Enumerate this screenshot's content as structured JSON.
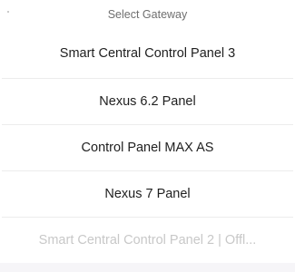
{
  "sheet": {
    "title": "Select Gateway",
    "options": [
      {
        "label": "Smart Central Control Panel 3",
        "disabled": false
      },
      {
        "label": "Nexus 6.2 Panel",
        "disabled": false
      },
      {
        "label": "Control Panel MAX AS",
        "disabled": false
      },
      {
        "label": "Nexus 7 Panel",
        "disabled": false
      },
      {
        "label": "Smart Central Control Panel 2 | Offl...",
        "disabled": true
      }
    ]
  }
}
